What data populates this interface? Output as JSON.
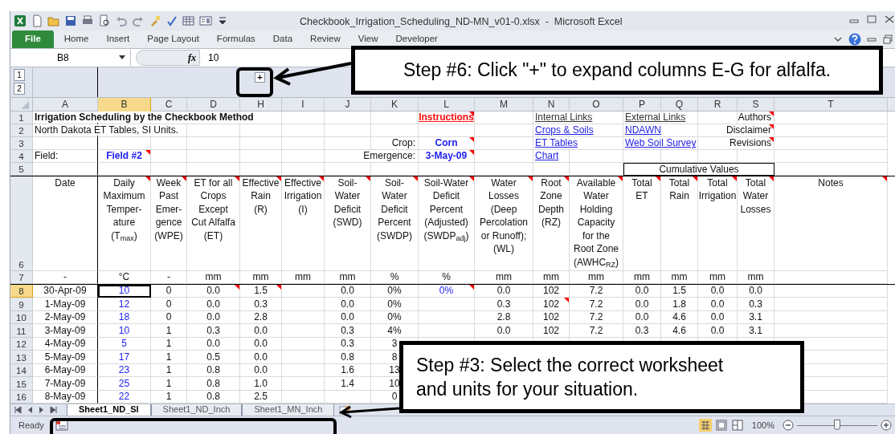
{
  "window": {
    "title": "Checkbook_Irrigation_Scheduling_ND-MN_v01-0.xlsx  -  Microsoft Excel"
  },
  "ribbon_tabs": [
    {
      "label": "File",
      "kind": "file"
    },
    {
      "label": "Home",
      "kind": "tab"
    },
    {
      "label": "Insert",
      "kind": "tab"
    },
    {
      "label": "Page Layout",
      "kind": "tab"
    },
    {
      "label": "Formulas",
      "kind": "tab"
    },
    {
      "label": "Data",
      "kind": "tab"
    },
    {
      "label": "Review",
      "kind": "tab"
    },
    {
      "label": "View",
      "kind": "tab"
    },
    {
      "label": "Developer",
      "kind": "tab"
    }
  ],
  "formula_bar": {
    "name_box": "B8",
    "function_label": "fx",
    "formula": "10"
  },
  "outline": {
    "levels": [
      "1",
      "2"
    ],
    "expand_button": "+"
  },
  "columns": [
    {
      "label": "A",
      "selected": false
    },
    {
      "label": "B",
      "selected": true
    },
    {
      "label": "C",
      "selected": false
    },
    {
      "label": "D",
      "selected": false
    },
    {
      "label": "H",
      "selected": false
    },
    {
      "label": "I",
      "selected": false
    },
    {
      "label": "J",
      "selected": false
    },
    {
      "label": "K",
      "selected": false
    },
    {
      "label": "L",
      "selected": false
    },
    {
      "label": "M",
      "selected": false
    },
    {
      "label": "N",
      "selected": false
    },
    {
      "label": "O",
      "selected": false
    },
    {
      "label": "P",
      "selected": false
    },
    {
      "label": "Q",
      "selected": false
    },
    {
      "label": "R",
      "selected": false
    },
    {
      "label": "S",
      "selected": false
    },
    {
      "label": "T",
      "selected": false
    }
  ],
  "rows": [
    {
      "number": "1",
      "selected": false,
      "cells": [
        {
          "text": "Irrigation Scheduling by the Checkbook Method",
          "kind": "title",
          "comment": false
        },
        null,
        null,
        null,
        null,
        null,
        null,
        null,
        {
          "text": "Instructions",
          "kind": "alert-link",
          "comment": true
        },
        null,
        {
          "text": "Internal Links",
          "kind": "section-link",
          "comment": false
        },
        null,
        {
          "text": "External Links",
          "kind": "section-link",
          "comment": false
        },
        null,
        null,
        {
          "text": "Authors",
          "kind": "right",
          "comment": true
        },
        null
      ]
    },
    {
      "number": "2",
      "selected": false,
      "cells": [
        {
          "text": "North Dakota ET Tables, SI Units.",
          "kind": "text",
          "comment": false
        },
        null,
        null,
        null,
        null,
        null,
        null,
        null,
        null,
        null,
        {
          "text": "Crops & Soils",
          "kind": "link",
          "comment": false
        },
        null,
        {
          "text": "NDAWN",
          "kind": "link",
          "comment": false
        },
        null,
        null,
        {
          "text": "Disclaimer",
          "kind": "right",
          "comment": true
        },
        null
      ]
    },
    {
      "number": "3",
      "selected": false,
      "cells": [
        null,
        null,
        null,
        null,
        null,
        null,
        null,
        {
          "text": "Crop:",
          "kind": "right",
          "comment": false
        },
        {
          "text": "Corn",
          "kind": "input",
          "comment": true
        },
        null,
        {
          "text": "ET Tables",
          "kind": "link",
          "comment": false
        },
        null,
        {
          "text": "Web Soil Survey",
          "kind": "link",
          "comment": false
        },
        null,
        null,
        {
          "text": "Revisions",
          "kind": "right",
          "comment": true
        },
        null
      ]
    },
    {
      "number": "4",
      "selected": false,
      "cells": [
        {
          "text": "Field:",
          "kind": "text",
          "comment": false
        },
        {
          "text": "Field #2",
          "kind": "input",
          "comment": true
        },
        null,
        null,
        null,
        null,
        null,
        {
          "text": "Emergence:",
          "kind": "right",
          "comment": false
        },
        {
          "text": "3-May-09",
          "kind": "input",
          "comment": true
        },
        null,
        {
          "text": "Chart",
          "kind": "link",
          "comment": false
        },
        null,
        null,
        null,
        null,
        null,
        null
      ]
    },
    {
      "number": "5",
      "selected": false,
      "cells": [
        null,
        null,
        null,
        null,
        null,
        null,
        null,
        null,
        null,
        null,
        null,
        null,
        {
          "text": "Cumulative Values",
          "kind": "group",
          "comment": false
        },
        null,
        null,
        null,
        null
      ]
    },
    {
      "number": "6",
      "selected": false,
      "cells": [
        {
          "text": "Date",
          "kind": "heading",
          "comment": false
        },
        {
          "text": "Daily\nMaximum\nTemper-\nature\n(T$_{max}$)",
          "kind": "heading",
          "comment": true
        },
        {
          "text": "Week\nPast\nEmer-\ngence\n(WPE)",
          "kind": "heading",
          "comment": true
        },
        {
          "text": "ET for all\nCrops\nExcept\nCut Alfalfa\n(ET)",
          "kind": "heading",
          "comment": true
        },
        {
          "text": "Effective\nRain\n(R)",
          "kind": "heading",
          "comment": true
        },
        {
          "text": "Effective\nIrrigation\n(I)",
          "kind": "heading",
          "comment": true
        },
        {
          "text": "Soil-\nWater\nDeficit\n(SWD)",
          "kind": "heading",
          "comment": true
        },
        {
          "text": "Soil-\nWater\nDeficit\nPercent\n(SWDP)",
          "kind": "heading",
          "comment": true
        },
        {
          "text": "Soil-Water\nDeficit\nPercent\n(Adjusted)\n(SWDP$_{adj}$)",
          "kind": "heading",
          "comment": true
        },
        {
          "text": "Water\nLosses\n(Deep\nPercolation\nor Runoff);\n(WL)",
          "kind": "heading",
          "comment": true
        },
        {
          "text": "Root\nZone\nDepth\n(RZ)",
          "kind": "heading",
          "comment": true
        },
        {
          "text": "Available\nWater\nHolding\nCapacity\nfor the\nRoot Zone\n(AWHC$_{RZ}$)",
          "kind": "heading",
          "comment": true
        },
        {
          "text": "Total\nET",
          "kind": "heading",
          "comment": true
        },
        {
          "text": "Total\nRain",
          "kind": "heading",
          "comment": true
        },
        {
          "text": "Total\nIrrigation",
          "kind": "heading",
          "comment": true
        },
        {
          "text": "Total\nWater\nLosses",
          "kind": "heading",
          "comment": true
        },
        {
          "text": "Notes",
          "kind": "heading",
          "comment": true
        }
      ]
    },
    {
      "number": "7",
      "selected": false,
      "cells": [
        {
          "text": "-",
          "kind": "value",
          "comment": false
        },
        {
          "text": "°C",
          "kind": "value",
          "comment": false
        },
        {
          "text": "-",
          "kind": "value",
          "comment": false
        },
        {
          "text": "mm",
          "kind": "value",
          "comment": false
        },
        {
          "text": "mm",
          "kind": "value",
          "comment": false
        },
        {
          "text": "mm",
          "kind": "value",
          "comment": false
        },
        {
          "text": "mm",
          "kind": "value",
          "comment": false
        },
        {
          "text": "%",
          "kind": "value",
          "comment": false
        },
        {
          "text": "%",
          "kind": "value",
          "comment": false
        },
        {
          "text": "mm",
          "kind": "value",
          "comment": false
        },
        {
          "text": "mm",
          "kind": "value",
          "comment": false
        },
        {
          "text": "mm",
          "kind": "value",
          "comment": false
        },
        {
          "text": "mm",
          "kind": "value",
          "comment": false
        },
        {
          "text": "mm",
          "kind": "value",
          "comment": false
        },
        {
          "text": "mm",
          "kind": "value",
          "comment": false
        },
        {
          "text": "mm",
          "kind": "value",
          "comment": false
        },
        null
      ]
    },
    {
      "number": "8",
      "selected": true,
      "cells": [
        {
          "text": "30-Apr-09",
          "kind": "value",
          "comment": false
        },
        {
          "text": "10",
          "kind": "entry",
          "comment": false
        },
        {
          "text": "0",
          "kind": "value",
          "comment": false
        },
        {
          "text": "0.0",
          "kind": "value",
          "comment": true
        },
        {
          "text": "1.5",
          "kind": "value",
          "comment": true
        },
        null,
        {
          "text": "0.0",
          "kind": "value",
          "comment": false
        },
        {
          "text": "0%",
          "kind": "value",
          "comment": false
        },
        {
          "text": "0%",
          "kind": "entry",
          "comment": true
        },
        {
          "text": "0.0",
          "kind": "value",
          "comment": false
        },
        {
          "text": "102",
          "kind": "value",
          "comment": false
        },
        {
          "text": "7.2",
          "kind": "value",
          "comment": false
        },
        {
          "text": "0.0",
          "kind": "value",
          "comment": false
        },
        {
          "text": "1.5",
          "kind": "value",
          "comment": false
        },
        {
          "text": "0.0",
          "kind": "value",
          "comment": false
        },
        {
          "text": "0.0",
          "kind": "value",
          "comment": false
        },
        null
      ]
    },
    {
      "number": "9",
      "selected": false,
      "cells": [
        {
          "text": "1-May-09",
          "kind": "value",
          "comment": false
        },
        {
          "text": "12",
          "kind": "entry",
          "comment": false
        },
        {
          "text": "0",
          "kind": "value",
          "comment": false
        },
        {
          "text": "0.0",
          "kind": "value",
          "comment": false
        },
        {
          "text": "0.3",
          "kind": "value",
          "comment": false
        },
        null,
        {
          "text": "0.0",
          "kind": "value",
          "comment": false
        },
        {
          "text": "0%",
          "kind": "value",
          "comment": false
        },
        null,
        {
          "text": "0.3",
          "kind": "value",
          "comment": false
        },
        {
          "text": "102",
          "kind": "value",
          "comment": true
        },
        {
          "text": "7.2",
          "kind": "value",
          "comment": false
        },
        {
          "text": "0.0",
          "kind": "value",
          "comment": false
        },
        {
          "text": "1.8",
          "kind": "value",
          "comment": false
        },
        {
          "text": "0.0",
          "kind": "value",
          "comment": false
        },
        {
          "text": "0.3",
          "kind": "value",
          "comment": false
        },
        null
      ]
    },
    {
      "number": "10",
      "selected": false,
      "cells": [
        {
          "text": "2-May-09",
          "kind": "value",
          "comment": false
        },
        {
          "text": "18",
          "kind": "entry",
          "comment": false
        },
        {
          "text": "0",
          "kind": "value",
          "comment": false
        },
        {
          "text": "0.0",
          "kind": "value",
          "comment": false
        },
        {
          "text": "2.8",
          "kind": "value",
          "comment": false
        },
        null,
        {
          "text": "0.0",
          "kind": "value",
          "comment": false
        },
        {
          "text": "0%",
          "kind": "value",
          "comment": false
        },
        null,
        {
          "text": "2.8",
          "kind": "value",
          "comment": false
        },
        {
          "text": "102",
          "kind": "value",
          "comment": false
        },
        {
          "text": "7.2",
          "kind": "value",
          "comment": false
        },
        {
          "text": "0.0",
          "kind": "value",
          "comment": false
        },
        {
          "text": "4.6",
          "kind": "value",
          "comment": false
        },
        {
          "text": "0.0",
          "kind": "value",
          "comment": false
        },
        {
          "text": "3.1",
          "kind": "value",
          "comment": false
        },
        null
      ]
    },
    {
      "number": "11",
      "selected": false,
      "cells": [
        {
          "text": "3-May-09",
          "kind": "value",
          "comment": false
        },
        {
          "text": "10",
          "kind": "entry",
          "comment": false
        },
        {
          "text": "1",
          "kind": "value",
          "comment": false
        },
        {
          "text": "0.3",
          "kind": "value",
          "comment": false
        },
        {
          "text": "0.0",
          "kind": "value",
          "comment": false
        },
        null,
        {
          "text": "0.3",
          "kind": "value",
          "comment": false
        },
        {
          "text": "4%",
          "kind": "value",
          "comment": false
        },
        null,
        {
          "text": "0.0",
          "kind": "value",
          "comment": false
        },
        {
          "text": "102",
          "kind": "value",
          "comment": false
        },
        {
          "text": "7.2",
          "kind": "value",
          "comment": false
        },
        {
          "text": "0.3",
          "kind": "value",
          "comment": false
        },
        {
          "text": "4.6",
          "kind": "value",
          "comment": false
        },
        {
          "text": "0.0",
          "kind": "value",
          "comment": false
        },
        {
          "text": "3.1",
          "kind": "value",
          "comment": false
        },
        null
      ]
    },
    {
      "number": "12",
      "selected": false,
      "cells": [
        {
          "text": "4-May-09",
          "kind": "value",
          "comment": false
        },
        {
          "text": "5",
          "kind": "entry",
          "comment": false
        },
        {
          "text": "1",
          "kind": "value",
          "comment": false
        },
        {
          "text": "0.0",
          "kind": "value",
          "comment": false
        },
        {
          "text": "0.0",
          "kind": "value",
          "comment": false
        },
        null,
        {
          "text": "0.3",
          "kind": "value",
          "comment": false
        },
        {
          "text": "3",
          "kind": "value",
          "comment": false
        },
        null,
        null,
        null,
        null,
        null,
        null,
        null,
        null,
        null
      ]
    },
    {
      "number": "13",
      "selected": false,
      "cells": [
        {
          "text": "5-May-09",
          "kind": "value",
          "comment": false
        },
        {
          "text": "17",
          "kind": "entry",
          "comment": false
        },
        {
          "text": "1",
          "kind": "value",
          "comment": false
        },
        {
          "text": "0.5",
          "kind": "value",
          "comment": false
        },
        {
          "text": "0.0",
          "kind": "value",
          "comment": false
        },
        null,
        {
          "text": "0.8",
          "kind": "value",
          "comment": false
        },
        {
          "text": "8",
          "kind": "value",
          "comment": false
        },
        null,
        null,
        null,
        null,
        null,
        null,
        null,
        null,
        null
      ]
    },
    {
      "number": "14",
      "selected": false,
      "cells": [
        {
          "text": "6-May-09",
          "kind": "value",
          "comment": false
        },
        {
          "text": "23",
          "kind": "entry",
          "comment": false
        },
        {
          "text": "1",
          "kind": "value",
          "comment": false
        },
        {
          "text": "0.8",
          "kind": "value",
          "comment": false
        },
        {
          "text": "0.0",
          "kind": "value",
          "comment": false
        },
        null,
        {
          "text": "1.6",
          "kind": "value",
          "comment": false
        },
        {
          "text": "13",
          "kind": "value",
          "comment": false
        },
        null,
        null,
        null,
        null,
        null,
        null,
        null,
        null,
        null
      ]
    },
    {
      "number": "15",
      "selected": false,
      "cells": [
        {
          "text": "7-May-09",
          "kind": "value",
          "comment": false
        },
        {
          "text": "25",
          "kind": "entry",
          "comment": false
        },
        {
          "text": "1",
          "kind": "value",
          "comment": false
        },
        {
          "text": "0.8",
          "kind": "value",
          "comment": false
        },
        {
          "text": "1.0",
          "kind": "value",
          "comment": false
        },
        null,
        {
          "text": "1.4",
          "kind": "value",
          "comment": false
        },
        {
          "text": "10",
          "kind": "value",
          "comment": false
        },
        null,
        null,
        null,
        null,
        null,
        null,
        null,
        null,
        null
      ]
    },
    {
      "number": "16",
      "selected": false,
      "cells": [
        {
          "text": "8-May-09",
          "kind": "value",
          "comment": false
        },
        {
          "text": "22",
          "kind": "entry",
          "comment": false
        },
        {
          "text": "1",
          "kind": "value",
          "comment": false
        },
        {
          "text": "0.8",
          "kind": "value",
          "comment": false
        },
        {
          "text": "2.5",
          "kind": "value",
          "comment": false
        },
        null,
        null,
        {
          "text": "0",
          "kind": "value",
          "comment": false
        },
        null,
        null,
        null,
        null,
        null,
        null,
        null,
        null,
        null
      ]
    }
  ],
  "sheet_tabs": [
    {
      "label": "Sheet1_ND_SI",
      "selected": true
    },
    {
      "label": "Sheet1_ND_Inch",
      "selected": false
    },
    {
      "label": "Sheet1_MN_Inch",
      "selected": false
    }
  ],
  "status_bar": {
    "text": "Ready",
    "zoom": "100%",
    "zoom_level": {
      "level": 0.5
    }
  },
  "callouts": [
    {
      "text": "Step #6: Click \"+\" to expand columns E-G for alfalfa."
    },
    {
      "text": "Step #3: Select the correct worksheet\nand units for your situation."
    }
  ]
}
